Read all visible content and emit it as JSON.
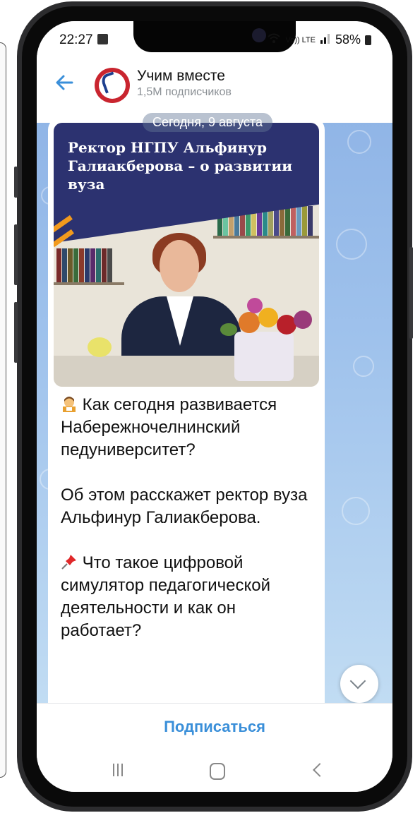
{
  "status_bar": {
    "time": "22:27",
    "network_label": "Vo)) LTE",
    "battery": "58%"
  },
  "header": {
    "channel_name": "Учим вместе",
    "subscribers": "1,5M подписчиков"
  },
  "chat": {
    "date_label": "Сегодня, 9 августа",
    "photo_title": "Ректор НГПУ Альфинур Галиакберова – о развитии вуза",
    "message_paragraphs": [
      "Как сегодня развивается Набережночелнинский педуниверситет?",
      "Об этом расскажет ректор вуза Альфинур Галиакберова.",
      "Что такое цифровой симулятор педагогической деятельности и как он работает?"
    ]
  },
  "subscribe_label": "Подписаться",
  "colors": {
    "accent": "#3a8fd9",
    "banner": "#2c3270",
    "chat_bg": "#9fc2ec"
  },
  "icons": [
    "back-arrow-icon",
    "wifi-icon",
    "signal-icon",
    "battery-icon",
    "chevron-down-icon",
    "recents-icon",
    "home-icon",
    "nav-back-icon",
    "teacher-emoji-icon",
    "pushpin-emoji-icon"
  ]
}
